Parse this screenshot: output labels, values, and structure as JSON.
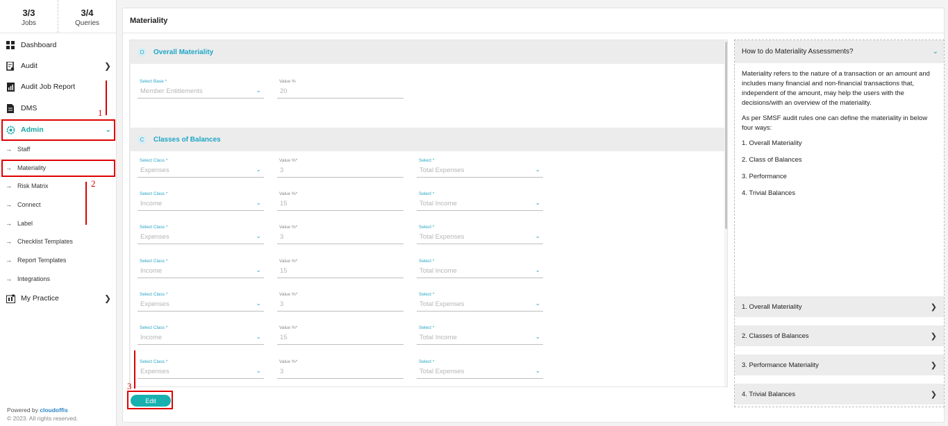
{
  "sidebar": {
    "stats": [
      {
        "value": "3/3",
        "label": "Jobs"
      },
      {
        "value": "3/4",
        "label": "Queries"
      }
    ],
    "nav": {
      "dashboard": "Dashboard",
      "audit": "Audit",
      "audit_job_report": "Audit Job Report",
      "dms": "DMS",
      "admin": "Admin",
      "my_practice": "My Practice"
    },
    "admin_sub": [
      "Staff",
      "Materiality",
      "Risk Matrix",
      "Connect",
      "Label",
      "Checklist Templates",
      "Report Templates",
      "Integrations"
    ],
    "footer": {
      "powered_by": "Powered by",
      "brand": "cloudoffis",
      "copyright": "© 2023. All rights reserved."
    }
  },
  "annotations": {
    "one": "1",
    "two": "2",
    "three": "3"
  },
  "main": {
    "title": "Materiality",
    "overall": {
      "badge": "O",
      "title": "Overall Materiality",
      "base_label": "Select Base *",
      "base_value": "Member Entitlements",
      "value_label": "Value %",
      "value": "20"
    },
    "classes": {
      "badge": "C",
      "title": "Classes of Balances",
      "class_label": "Select Class *",
      "value_label": "Value %*",
      "select_label": "Select *",
      "rows": [
        {
          "cls": "Expenses",
          "val": "3",
          "sel": "Total Expenses"
        },
        {
          "cls": "Income",
          "val": "15",
          "sel": "Total Income"
        },
        {
          "cls": "Expenses",
          "val": "3",
          "sel": "Total Expenses"
        },
        {
          "cls": "Income",
          "val": "15",
          "sel": "Total Income"
        },
        {
          "cls": "Expenses",
          "val": "3",
          "sel": "Total Expenses"
        },
        {
          "cls": "Income",
          "val": "15",
          "sel": "Total Income"
        },
        {
          "cls": "Expenses",
          "val": "3",
          "sel": "Total Expenses"
        }
      ]
    },
    "edit_label": "Edit"
  },
  "help": {
    "heading": "How to do Materiality Assessments?",
    "para1": "Materiality refers to the nature of a transaction or an amount and includes many financial and non-financial transactions that, independent of the amount, may help the users with the decisions/with an overview of the materiality.",
    "para2": "As per SMSF audit rules one can define the materiality in below four ways:",
    "list": [
      "1. Overall Materiality",
      "2. Class of Balances",
      "3. Performance",
      "4. Trivial Balances"
    ],
    "accordions": [
      "1. Overall Materiality",
      "2. Classes of Balances",
      "3. Performance Materiality",
      "4. Trivial Balances"
    ]
  },
  "colors": {
    "accent": "#19a5a5",
    "highlight": "#e00000"
  }
}
